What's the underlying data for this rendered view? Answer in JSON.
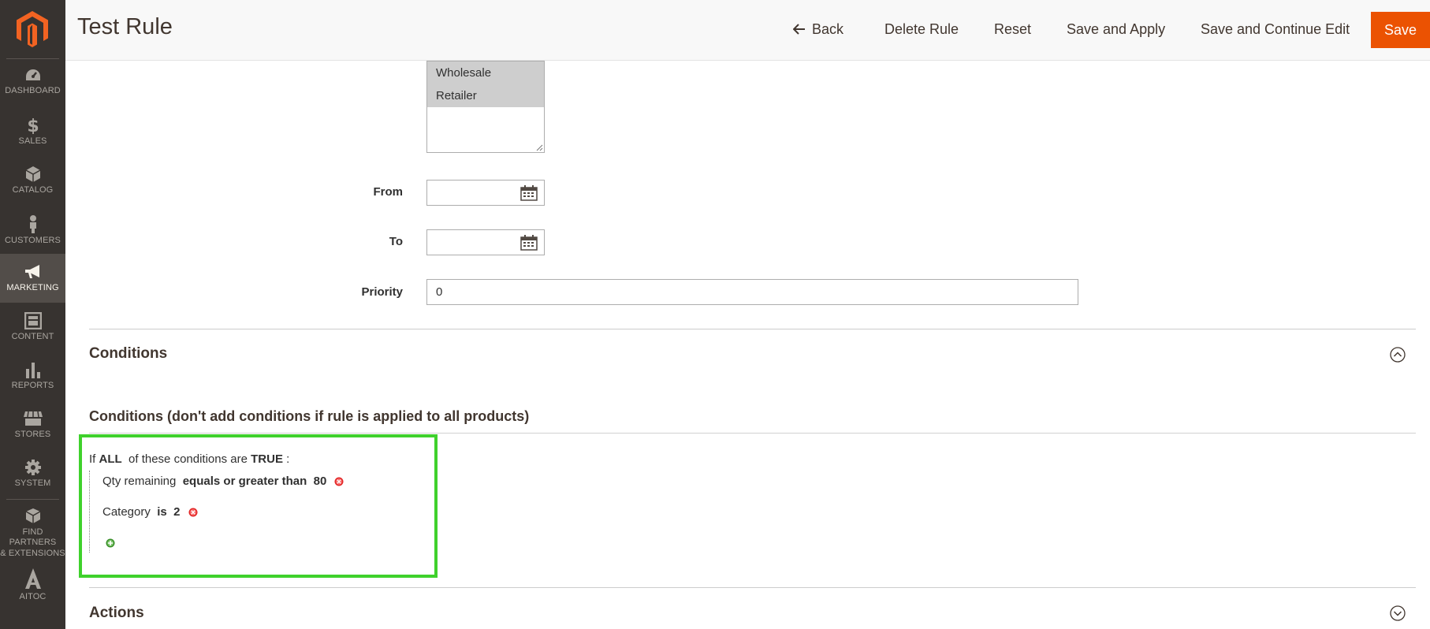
{
  "sidebar": {
    "items": [
      {
        "label": "DASHBOARD",
        "icon": "dashboard-icon"
      },
      {
        "label": "SALES",
        "icon": "dollar-icon"
      },
      {
        "label": "CATALOG",
        "icon": "box-icon"
      },
      {
        "label": "CUSTOMERS",
        "icon": "person-icon"
      },
      {
        "label": "MARKETING",
        "icon": "megaphone-icon",
        "active": true
      },
      {
        "label": "CONTENT",
        "icon": "layout-icon"
      },
      {
        "label": "REPORTS",
        "icon": "bar-chart-icon"
      },
      {
        "label": "STORES",
        "icon": "store-icon"
      },
      {
        "label": "SYSTEM",
        "icon": "gear-icon"
      },
      {
        "label": "FIND PARTNERS & EXTENSIONS",
        "label_line1": "FIND PARTNERS",
        "label_line2": "& EXTENSIONS",
        "icon": "cubes-icon"
      },
      {
        "label": "AITOC",
        "icon": "aitoc-icon"
      }
    ]
  },
  "header": {
    "title": "Test Rule",
    "back_label": "Back",
    "delete_label": "Delete Rule",
    "reset_label": "Reset",
    "save_apply_label": "Save and Apply",
    "save_continue_label": "Save and Continue Edit",
    "save_label": "Save"
  },
  "form": {
    "customer_groups": [
      "Wholesale",
      "Retailer"
    ],
    "from_label": "From",
    "from_value": "",
    "to_label": "To",
    "to_value": "",
    "priority_label": "Priority",
    "priority_value": "0"
  },
  "conditions_section": {
    "title": "Conditions",
    "subtitle": "Conditions (don't add conditions if rule is applied to all products)",
    "root": {
      "prefix": "If",
      "aggregator": "ALL",
      "middle": "of these conditions are",
      "value": "TRUE",
      "suffix": ":"
    },
    "rules": [
      {
        "attribute": "Qty remaining",
        "operator": "equals or greater than",
        "value": "80"
      },
      {
        "attribute": "Category",
        "operator": "is",
        "value": "2"
      }
    ]
  },
  "actions_section": {
    "title": "Actions"
  },
  "colors": {
    "sidebar_bg": "#373330",
    "sidebar_active": "#524d49",
    "accent": "#eb5202",
    "highlight": "#3fd12c"
  }
}
